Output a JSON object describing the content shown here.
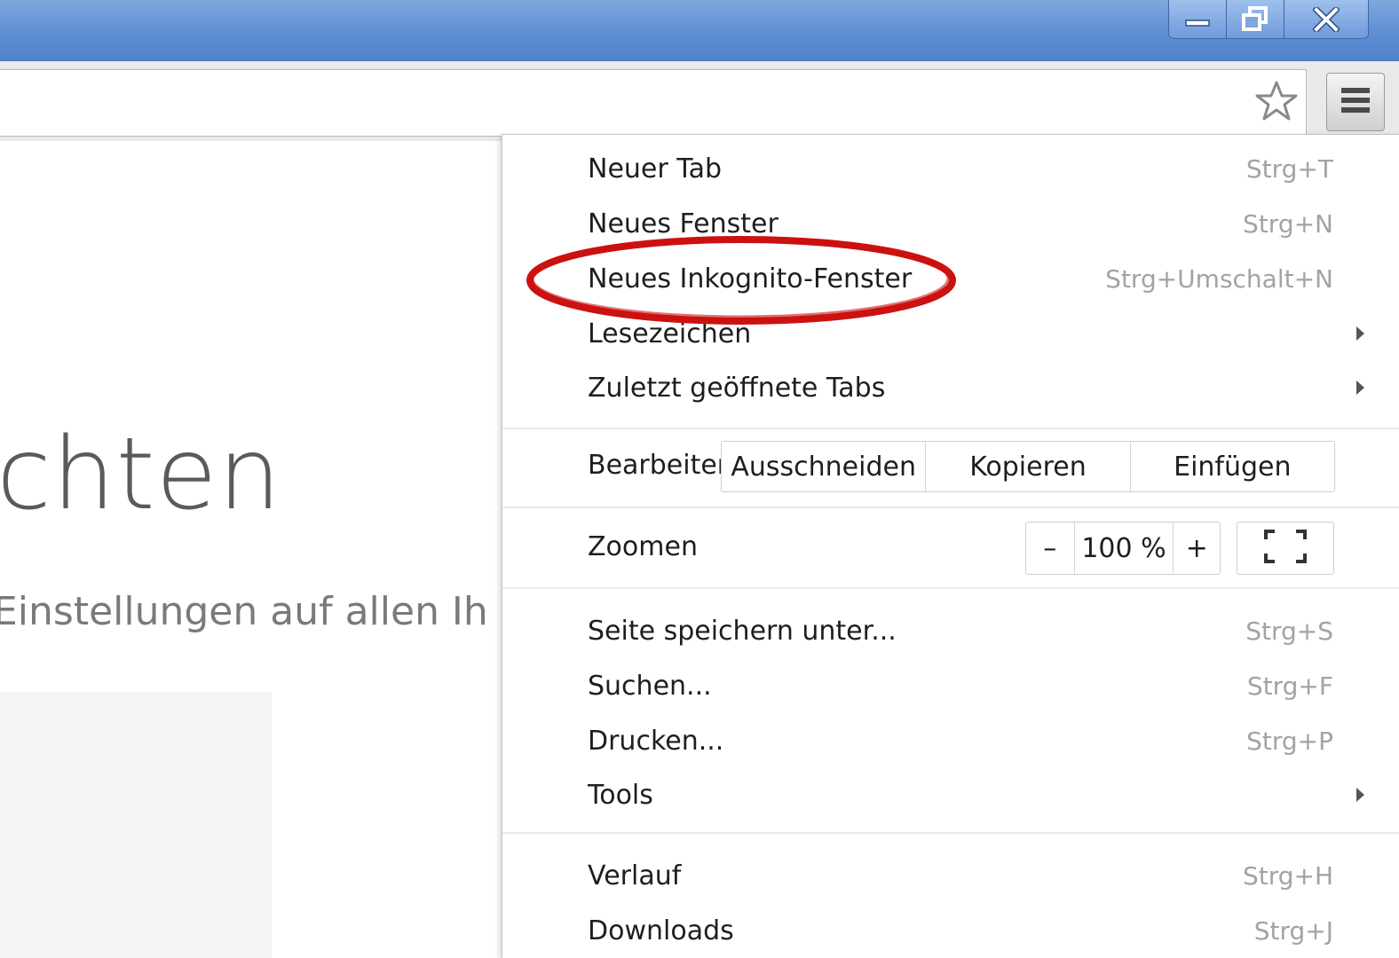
{
  "window": {
    "controls": {
      "minimize_icon": "minimize-icon",
      "restore_icon": "restore-icon",
      "close_icon": "close-icon"
    }
  },
  "toolbar": {
    "bookmark_icon": "star-icon",
    "menu_icon": "hamburger-menu-icon"
  },
  "page": {
    "heading": "ichten",
    "subtext": "Einstellungen auf allen Ih"
  },
  "menu": {
    "new_tab": {
      "label": "Neuer Tab",
      "shortcut": "Strg+T"
    },
    "new_window": {
      "label": "Neues Fenster",
      "shortcut": "Strg+N"
    },
    "incognito": {
      "label": "Neues Inkognito-Fenster",
      "shortcut": "Strg+Umschalt+N"
    },
    "bookmarks": {
      "label": "Lesezeichen"
    },
    "recent_tabs": {
      "label": "Zuletzt geöffnete Tabs"
    },
    "edit": {
      "label": "Bearbeiten",
      "cut": "Ausschneiden",
      "copy": "Kopieren",
      "paste": "Einfügen"
    },
    "zoom": {
      "label": "Zoomen",
      "minus": "–",
      "value": "100 %",
      "plus": "+",
      "fullscreen_icon": "fullscreen-icon"
    },
    "save_page": {
      "label": "Seite speichern unter...",
      "shortcut": "Strg+S"
    },
    "find": {
      "label": "Suchen...",
      "shortcut": "Strg+F"
    },
    "print": {
      "label": "Drucken...",
      "shortcut": "Strg+P"
    },
    "tools": {
      "label": "Tools"
    },
    "history": {
      "label": "Verlauf",
      "shortcut": "Strg+H"
    },
    "downloads": {
      "label": "Downloads",
      "shortcut": "Strg+J"
    }
  },
  "colors": {
    "titlebar": "#5f8fd4",
    "highlight": "#cc1111"
  }
}
